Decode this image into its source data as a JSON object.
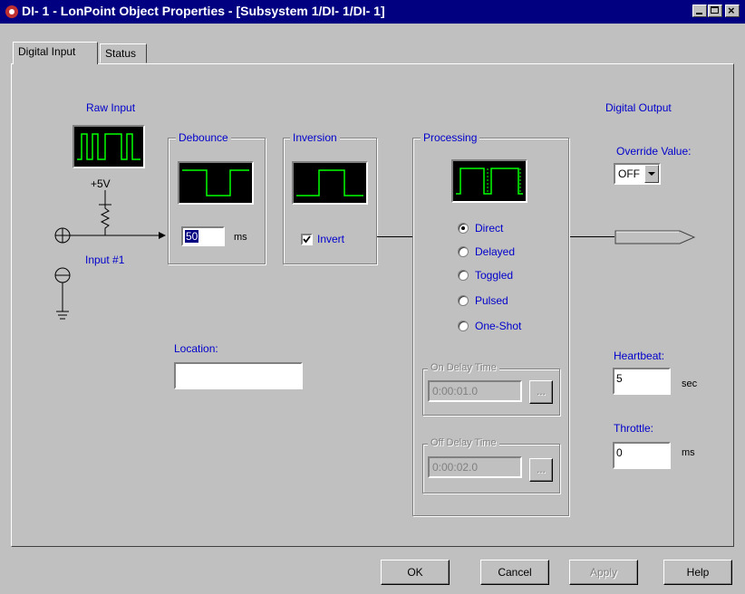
{
  "window": {
    "title": "DI- 1 - LonPoint Object Properties - [Subsystem 1/DI- 1/DI- 1]",
    "caption_buttons": [
      "minimize-icon",
      "maximize-icon",
      "close-icon"
    ]
  },
  "tabs": [
    {
      "label": "Digital Input",
      "active": true
    },
    {
      "label": "Status",
      "active": false
    }
  ],
  "raw_input": {
    "label": "Raw Input"
  },
  "circuit": {
    "voltage": "+5V",
    "input_label": "Input #1"
  },
  "debounce": {
    "label": "Debounce",
    "value": "50",
    "unit": "ms"
  },
  "inversion": {
    "label": "Inversion",
    "checkbox_label": "Invert",
    "checked": true
  },
  "processing": {
    "label": "Processing",
    "options": [
      {
        "label": "Direct",
        "selected": true
      },
      {
        "label": "Delayed",
        "selected": false
      },
      {
        "label": "Toggled",
        "selected": false
      },
      {
        "label": "Pulsed",
        "selected": false
      },
      {
        "label": "One-Shot",
        "selected": false
      }
    ],
    "on_delay": {
      "label": "On Delay Time",
      "value": "0:00:01.0",
      "button": "..."
    },
    "off_delay": {
      "label": "Off Delay Time",
      "value": "0:00:02.0",
      "button": "..."
    }
  },
  "location": {
    "label": "Location:",
    "value": ""
  },
  "digital_output": {
    "label": "Digital Output",
    "override_label": "Override Value:",
    "override_value": "OFF",
    "heartbeat_label": "Heartbeat:",
    "heartbeat_value": "5",
    "heartbeat_unit": "sec",
    "throttle_label": "Throttle:",
    "throttle_value": "0",
    "throttle_unit": "ms"
  },
  "buttons": {
    "ok": "OK",
    "cancel": "Cancel",
    "apply": "Apply",
    "help": "Help"
  },
  "colors": {
    "title_bar": "#000080",
    "label_blue": "#0000cc",
    "wave_green": "#00ff00",
    "face": "#c0c0c0"
  }
}
